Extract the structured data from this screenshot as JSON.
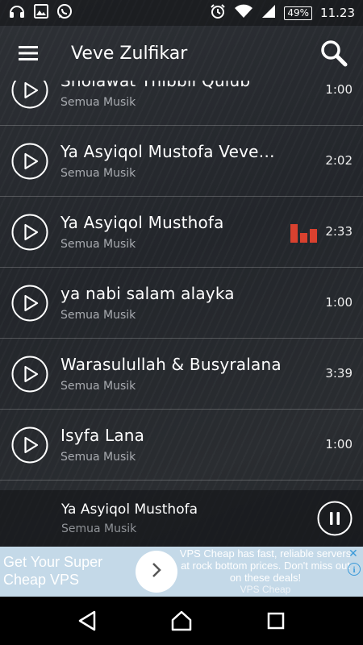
{
  "status_bar": {
    "left_icons": [
      "headset-icon",
      "image-icon",
      "whatsapp-icon"
    ],
    "right_icons": [
      "alarm-icon",
      "wifi-icon",
      "signal-icon"
    ],
    "battery": "49%",
    "time": "11.23"
  },
  "app_bar": {
    "title": "Veve Zulfikar",
    "menu_icon": "menu-icon",
    "search_icon": "search-icon"
  },
  "tracks": [
    {
      "title": "Sholawat Thibbil Qulub",
      "subtitle": "Semua Musik",
      "duration": "1:00",
      "playing": false
    },
    {
      "title": "Ya Asyiqol Mustofa Veve…",
      "subtitle": "Semua Musik",
      "duration": "2:02",
      "playing": false
    },
    {
      "title": "Ya Asyiqol Musthofa",
      "subtitle": "Semua Musik",
      "duration": "2:33",
      "playing": true
    },
    {
      "title": "ya nabi salam alayka",
      "subtitle": "Semua Musik",
      "duration": "1:00",
      "playing": false
    },
    {
      "title": "Warasulullah & Busyralana",
      "subtitle": "Semua Musik",
      "duration": "3:39",
      "playing": false
    },
    {
      "title": "Isyfa Lana",
      "subtitle": "Semua Musik",
      "duration": "1:00",
      "playing": false
    }
  ],
  "now_playing": {
    "title": "Ya Asyiqol Musthofa",
    "subtitle": "Semua Musik",
    "control_icon": "pause-icon"
  },
  "ad": {
    "headline": "Get Your Super Cheap VPS",
    "body": "VPS Cheap has fast, reliable servers at rock bottom prices. Don't miss out on these deals!",
    "source": "VPS Cheap",
    "close_icon": "close-icon",
    "info_icon": "info-icon",
    "info_glyph": "i",
    "close_glyph": "✕"
  },
  "colors": {
    "equalizer": "#d9412f",
    "ad_background": "#c4d9e8",
    "ad_accent": "#3a9ad9"
  }
}
